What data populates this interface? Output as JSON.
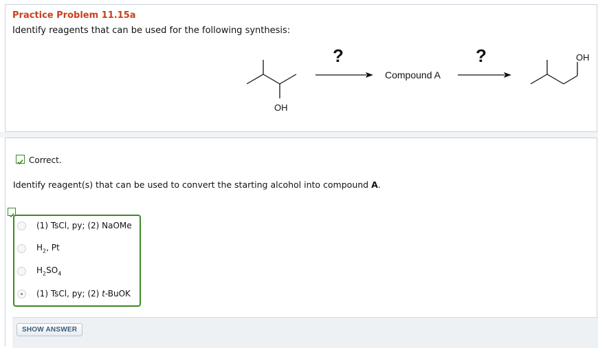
{
  "problem": {
    "title": "Practice Problem 11.15a",
    "prompt": "Identify reagents that can be used for the following synthesis:"
  },
  "scheme": {
    "arrow1_label": "?",
    "intermediate": "Compound A",
    "arrow2_label": "?",
    "start_oh": "OH",
    "product_oh": "OH"
  },
  "feedback": {
    "status": "Correct."
  },
  "question": {
    "text_prefix": "Identify reagent(s) that can be used to convert the starting alcohol into compound ",
    "text_bold": "A",
    "text_suffix": "."
  },
  "options": [
    {
      "label": "(1) TsCl, py; (2) NaOMe",
      "selected": false
    },
    {
      "label": "H2, Pt",
      "selected": false
    },
    {
      "label": "H2SO4",
      "selected": false
    },
    {
      "label": "(1) TsCl, py; (2) t-BuOK",
      "selected": true
    }
  ],
  "option_parts": {
    "h2_main": "H",
    "h2_sub": "2",
    "h2_rest": ", Pt",
    "h2so4_a": "H",
    "h2so4_sub1": "2",
    "h2so4_b": "SO",
    "h2so4_sub2": "4",
    "tbu_a": "(1) TsCl, py; (2) ",
    "tbu_i": "t",
    "tbu_b": "-BuOK"
  },
  "actions": {
    "show_answer": "SHOW ANSWER"
  },
  "colors": {
    "title": "#c8401a",
    "correct_green": "#3a8a24",
    "panel_border": "#c9d2dc",
    "button_text": "#3d5a7a"
  }
}
